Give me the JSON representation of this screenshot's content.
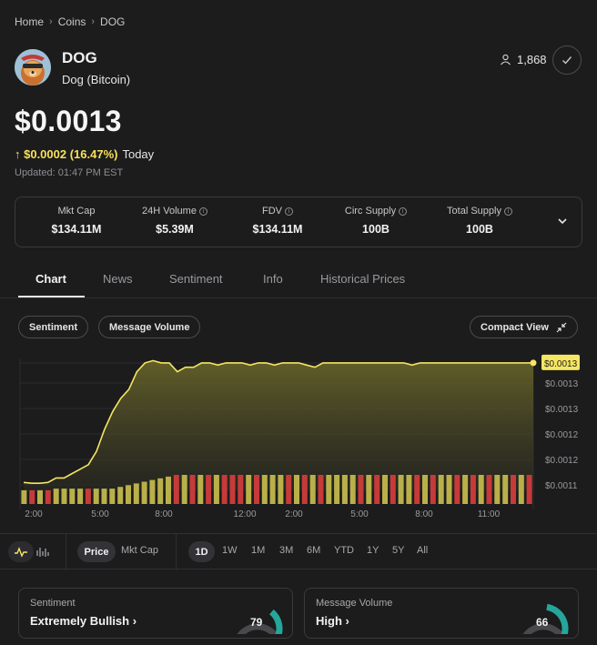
{
  "breadcrumb": {
    "home": "Home",
    "coins": "Coins",
    "current": "DOG"
  },
  "coin": {
    "symbol": "DOG",
    "name": "Dog (Bitcoin)",
    "watchers": "1,868"
  },
  "price": {
    "value": "$0.0013",
    "change": "↑ $0.0002 (16.47%)",
    "change_period": "Today",
    "updated": "Updated: 01:47 PM EST"
  },
  "stats": [
    {
      "label": "Mkt Cap",
      "value": "$134.11M",
      "info": false
    },
    {
      "label": "24H Volume",
      "value": "$5.39M",
      "info": true
    },
    {
      "label": "FDV",
      "value": "$134.11M",
      "info": true
    },
    {
      "label": "Circ Supply",
      "value": "100B",
      "info": true
    },
    {
      "label": "Total Supply",
      "value": "100B",
      "info": true
    }
  ],
  "tabs": [
    "Chart",
    "News",
    "Sentiment",
    "Info",
    "Historical Prices"
  ],
  "chart_controls": {
    "sentiment": "Sentiment",
    "message_volume": "Message Volume",
    "compact_view": "Compact View"
  },
  "chart_data": {
    "type": "line",
    "x_labels": [
      "2:00",
      "5:00",
      "8:00",
      "12:00",
      "2:00",
      "5:00",
      "8:00",
      "11:00"
    ],
    "y_tick_labels": [
      "$0.0013",
      "$0.0013",
      "$0.0012",
      "$0.0012",
      "$0.0011"
    ],
    "current_label": "$0.0013",
    "line_color": "#f5e663",
    "price_series": [
      0.00112,
      0.001118,
      0.001118,
      0.00112,
      0.00113,
      0.00113,
      0.00114,
      0.00115,
      0.00116,
      0.00119,
      0.00124,
      0.00128,
      0.00131,
      0.00133,
      0.00137,
      0.00139,
      0.001395,
      0.00139,
      0.00139,
      0.00137,
      0.00138,
      0.00138,
      0.00139,
      0.00139,
      0.001385,
      0.00139,
      0.00139,
      0.00139,
      0.001385,
      0.00139,
      0.00139,
      0.001385,
      0.00139,
      0.00139,
      0.00139,
      0.001385,
      0.00138,
      0.00139,
      0.00139,
      0.00139,
      0.00139,
      0.00139,
      0.00139,
      0.00139,
      0.00139,
      0.00139,
      0.00139,
      0.00139,
      0.001385,
      0.00139,
      0.00139,
      0.00139,
      0.00139,
      0.00139,
      0.00139,
      0.00139,
      0.00139,
      0.00139,
      0.00139,
      0.00139,
      0.00139,
      0.00139,
      0.00139,
      0.00139
    ],
    "volume_colors": [
      "g",
      "r",
      "g",
      "r",
      "g",
      "g",
      "g",
      "g",
      "r",
      "g",
      "g",
      "g",
      "g",
      "g",
      "g",
      "g",
      "g",
      "g",
      "g",
      "r",
      "g",
      "r",
      "g",
      "r",
      "g",
      "r",
      "r",
      "r",
      "g",
      "r",
      "g",
      "g",
      "g",
      "r",
      "g",
      "r",
      "g",
      "r",
      "g",
      "g",
      "g",
      "g",
      "r",
      "g",
      "r",
      "g",
      "r",
      "g",
      "g",
      "r",
      "g",
      "r",
      "g",
      "g",
      "r",
      "g",
      "r",
      "g",
      "r",
      "g",
      "g",
      "r",
      "g",
      "r"
    ],
    "volume_values": [
      0.4,
      0.4,
      0.4,
      0.4,
      0.45,
      0.45,
      0.45,
      0.45,
      0.45,
      0.45,
      0.45,
      0.45,
      0.5,
      0.55,
      0.6,
      0.65,
      0.7,
      0.75,
      0.8,
      0.85,
      0.85,
      0.85,
      0.85,
      0.85,
      0.85,
      0.85,
      0.85,
      0.85,
      0.85,
      0.85,
      0.85,
      0.85,
      0.85,
      0.85,
      0.85,
      0.85,
      0.85,
      0.85,
      0.85,
      0.85,
      0.85,
      0.85,
      0.85,
      0.85,
      0.85,
      0.85,
      0.85,
      0.85,
      0.85,
      0.85,
      0.85,
      0.85,
      0.85,
      0.85,
      0.85,
      0.85,
      0.85,
      0.85,
      0.85,
      0.85,
      0.85,
      0.85,
      0.85,
      0.85
    ]
  },
  "bottom_bar": {
    "price": "Price",
    "mkt_cap": "Mkt Cap",
    "ranges": [
      "1D",
      "1W",
      "1M",
      "3M",
      "6M",
      "YTD",
      "1Y",
      "5Y",
      "All"
    ],
    "selected_range": "1D"
  },
  "sentiment_card": {
    "label": "Sentiment",
    "value": "Extremely Bullish",
    "score": "79",
    "score_pct": 79
  },
  "volume_card": {
    "label": "Message Volume",
    "value": "High",
    "score": "66",
    "score_pct": 66
  },
  "colors": {
    "accent_yellow": "#f5e663",
    "bar_green": "#b9b04a",
    "bar_red": "#c73a3a",
    "gauge_teal": "#26a69a"
  }
}
